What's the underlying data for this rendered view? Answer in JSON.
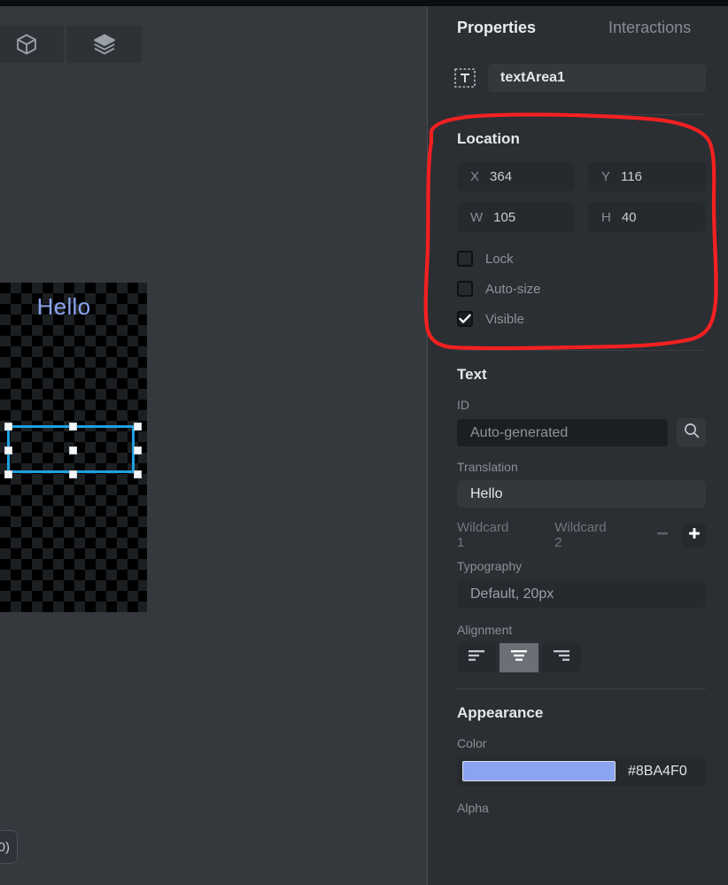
{
  "panel": {
    "tabs": [
      {
        "label": "Properties",
        "active": true
      },
      {
        "label": "Interactions",
        "active": false
      }
    ],
    "element_name": "textArea1",
    "name_icon": "text-area-icon"
  },
  "location": {
    "title": "Location",
    "fields": [
      {
        "key": "X",
        "value": "364"
      },
      {
        "key": "Y",
        "value": "116"
      },
      {
        "key": "W",
        "value": "105"
      },
      {
        "key": "H",
        "value": "40"
      }
    ],
    "checkboxes": [
      {
        "label": "Lock",
        "checked": false
      },
      {
        "label": "Auto-size",
        "checked": false
      },
      {
        "label": "Visible",
        "checked": true
      }
    ]
  },
  "text": {
    "title": "Text",
    "id_label": "ID",
    "id_value": "Auto-generated",
    "search_icon": "search-icon",
    "translation_label": "Translation",
    "translation_value": "Hello",
    "wildcard1": "Wildcard 1",
    "wildcard2": "Wildcard 2",
    "remove_icon": "minus-icon",
    "add_icon": "plus-icon",
    "typography_label": "Typography",
    "typography_value": "Default, 20px",
    "alignment_label": "Alignment",
    "alignment_options": [
      {
        "name": "align-left",
        "selected": false
      },
      {
        "name": "align-center",
        "selected": true
      },
      {
        "name": "align-right",
        "selected": false
      }
    ]
  },
  "appearance": {
    "title": "Appearance",
    "color_label": "Color",
    "color_hex": "#8BA4F0",
    "alpha_label": "Alpha"
  },
  "editor": {
    "tools": [
      {
        "name": "cube-icon",
        "label": "3D View"
      },
      {
        "name": "layers-icon",
        "label": "Layers"
      }
    ],
    "canvas_text": "Hello",
    "canvas_text_color": "#8BA4F0",
    "selection_color": "#1EA0E0",
    "coord_readout": "0)"
  },
  "annotation": {
    "type": "hand-drawn-circle",
    "color": "#F42020",
    "targets": "Location section"
  }
}
